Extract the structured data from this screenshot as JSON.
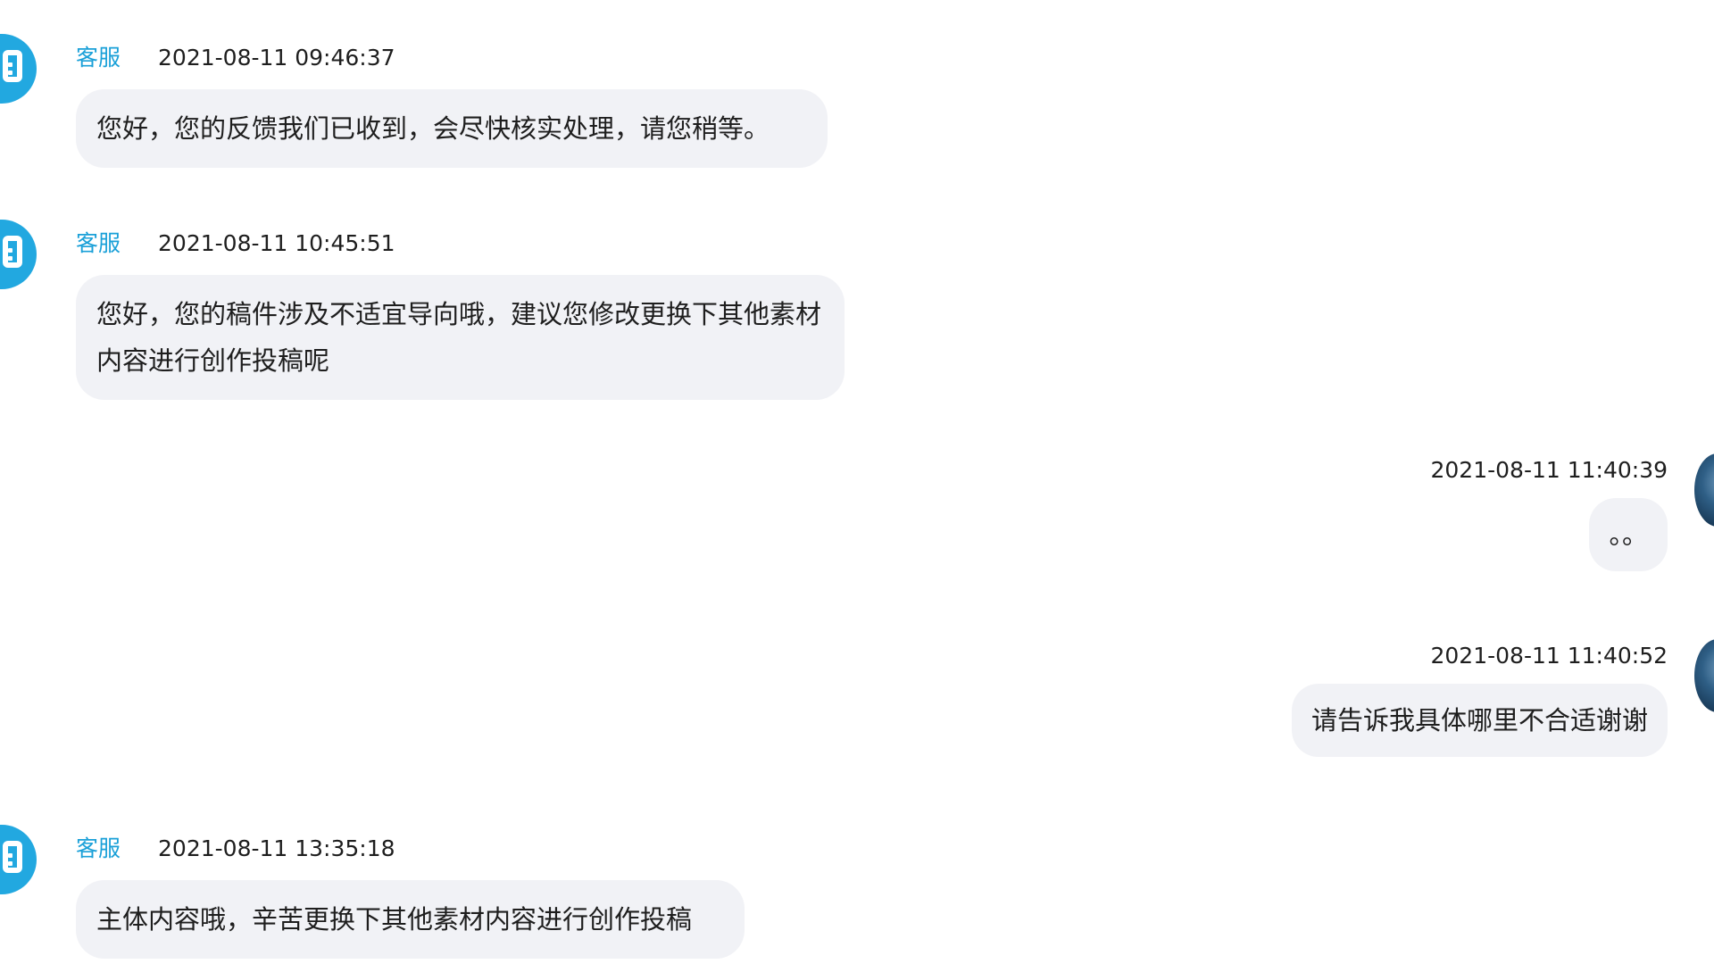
{
  "messages": [
    {
      "role": "agent",
      "sender": "客服",
      "time": "2021-08-11 09:46:37",
      "text": "您好，您的反馈我们已收到，会尽快核实处理，请您稍等。"
    },
    {
      "role": "agent",
      "sender": "客服",
      "time": "2021-08-11 10:45:51",
      "text": "您好，您的稿件涉及不适宜导向哦，建议您修改更换下其他素材内容进行创作投稿呢"
    },
    {
      "role": "user",
      "time": "2021-08-11 11:40:39",
      "text": "。。"
    },
    {
      "role": "user",
      "time": "2021-08-11 11:40:52",
      "text": "请告诉我具体哪里不合适谢谢"
    },
    {
      "role": "agent",
      "sender": "客服",
      "time": "2021-08-11 13:35:18",
      "text": "主体内容哦，辛苦更换下其他素材内容进行创作投稿"
    }
  ],
  "colors": {
    "agent_name": "#1aa0d8",
    "agent_avatar": "#22a8e0",
    "bubble_bg": "#f1f2f6",
    "text": "#1e1e1e"
  },
  "icons": {
    "agent_avatar": "robot-tv-icon",
    "user_avatar": "user-avatar-icon"
  }
}
